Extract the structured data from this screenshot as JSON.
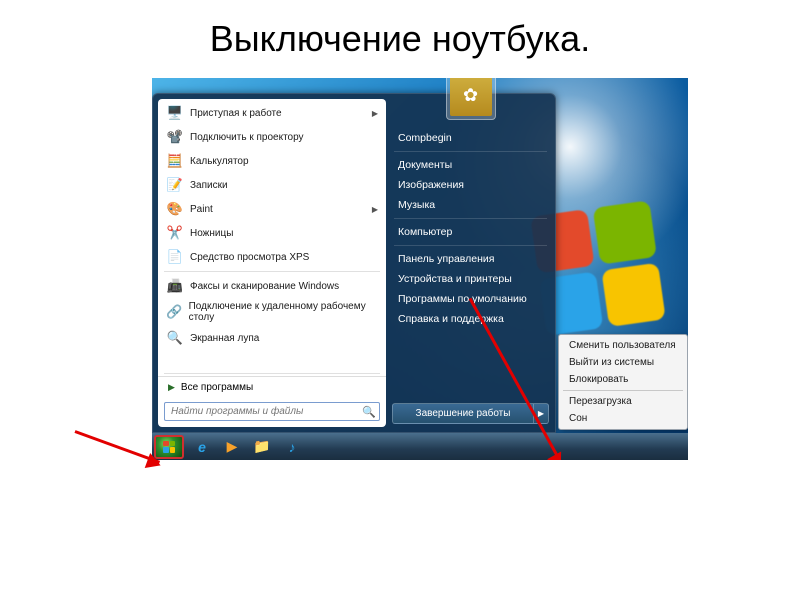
{
  "slide": {
    "title": "Выключение ноутбука."
  },
  "start_menu": {
    "programs": [
      {
        "icon": "🖥️",
        "label": "Приступая к работе",
        "expandable": true
      },
      {
        "icon": "📽️",
        "label": "Подключить к проектору"
      },
      {
        "icon": "🧮",
        "label": "Калькулятор"
      },
      {
        "icon": "📝",
        "label": "Записки"
      },
      {
        "icon": "🎨",
        "label": "Paint",
        "expandable": true
      },
      {
        "icon": "✂️",
        "label": "Ножницы"
      },
      {
        "icon": "📄",
        "label": "Средство просмотра XPS"
      },
      {
        "icon": "📠",
        "label": "Факсы и сканирование Windows"
      },
      {
        "icon": "🔗",
        "label": "Подключение к удаленному рабочему столу"
      },
      {
        "icon": "🔍",
        "label": "Экранная лупа"
      }
    ],
    "all_programs": "Все программы",
    "search_placeholder": "Найти программы и файлы",
    "right_column": {
      "username": "Compbegin",
      "items_a": [
        "Документы",
        "Изображения",
        "Музыка"
      ],
      "items_b": [
        "Компьютер"
      ],
      "items_c": [
        "Панель управления",
        "Устройства и принтеры",
        "Программы по умолчанию",
        "Справка и поддержка"
      ]
    },
    "shutdown_label": "Завершение работы"
  },
  "power_menu": {
    "items_top": [
      "Сменить пользователя",
      "Выйти из системы",
      "Блокировать"
    ],
    "items_bottom": [
      "Перезагрузка",
      "Сон"
    ]
  },
  "taskbar_icons": [
    {
      "name": "ie-icon",
      "glyph": "e",
      "color": "#2aa3e8"
    },
    {
      "name": "media-player-icon",
      "glyph": "▶",
      "color": "#f7a22b"
    },
    {
      "name": "explorer-icon",
      "glyph": "📁",
      "color": ""
    },
    {
      "name": "itunes-icon",
      "glyph": "♪",
      "color": "#2aa3e8"
    }
  ]
}
